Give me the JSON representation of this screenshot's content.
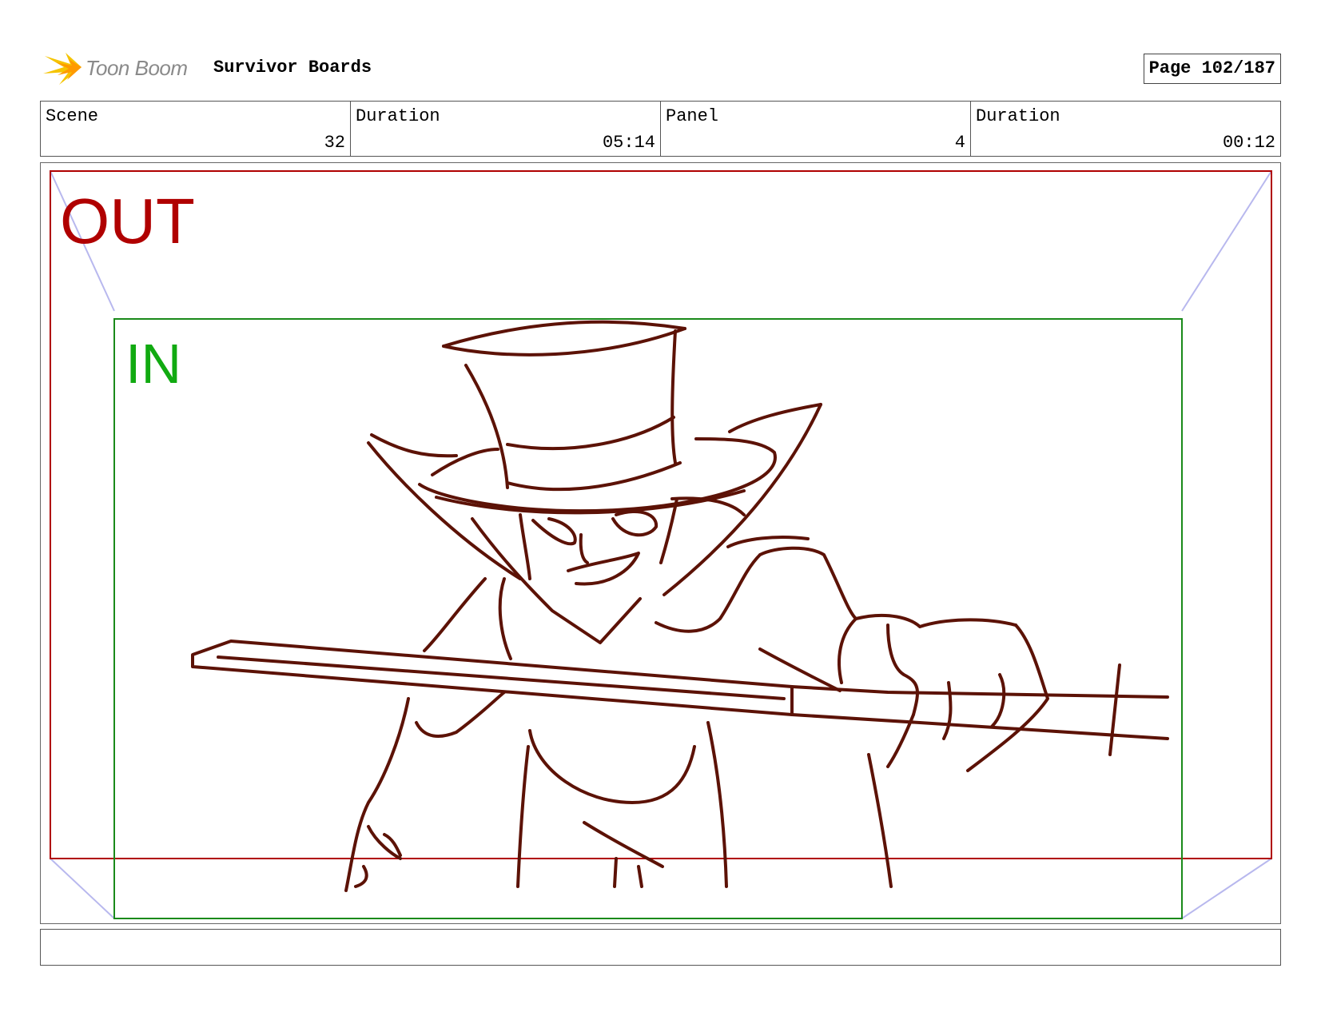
{
  "header": {
    "logo_text": "Toon Boom",
    "project_title": "Survivor Boards",
    "page_label": "Page 102/187"
  },
  "info": {
    "scene": {
      "label": "Scene",
      "value": "32"
    },
    "scene_duration": {
      "label": "Duration",
      "value": "05:14"
    },
    "panel": {
      "label": "Panel",
      "value": "4"
    },
    "panel_duration": {
      "label": "Duration",
      "value": "00:12"
    }
  },
  "frame": {
    "out_label": "OUT",
    "in_label": "IN",
    "out_color": "#b00000",
    "in_color": "#1a8a1a",
    "sketch_color": "#5c1206"
  },
  "caption": {
    "text": ""
  }
}
